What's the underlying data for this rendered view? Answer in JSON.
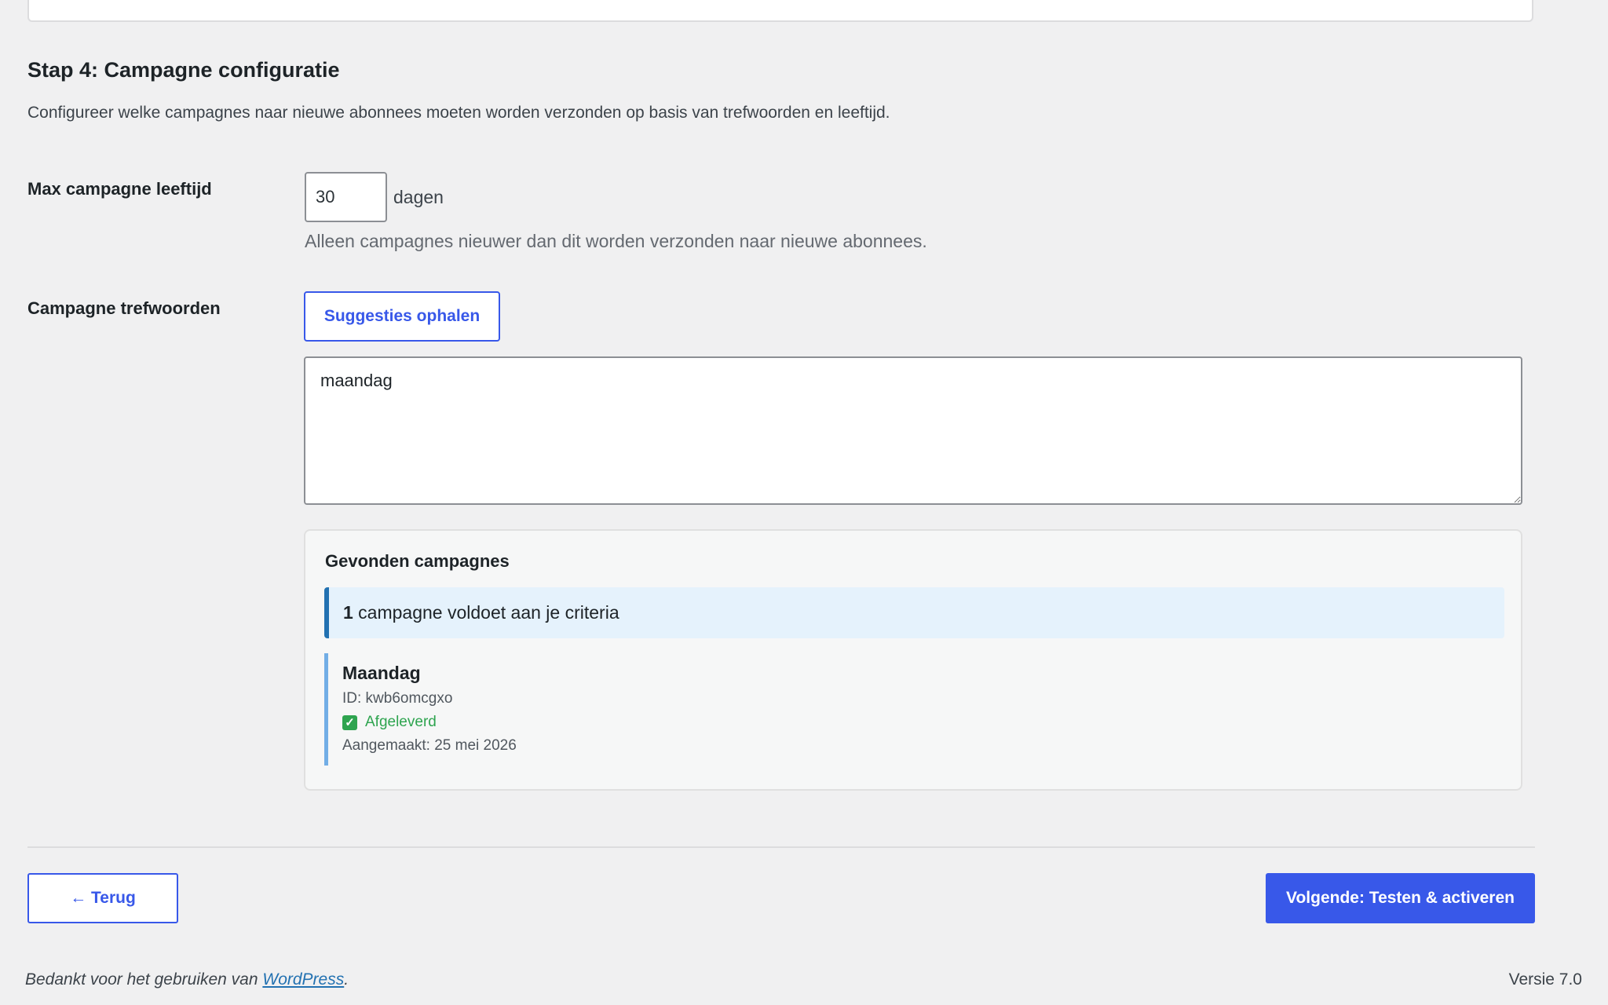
{
  "step": {
    "title": "Stap 4: Campagne configuratie",
    "description": "Configureer welke campagnes naar nieuwe abonnees moeten worden verzonden op basis van trefwoorden en leeftijd."
  },
  "max_age": {
    "label": "Max campagne leeftijd",
    "value": "30",
    "unit": "dagen",
    "help": "Alleen campagnes nieuwer dan dit worden verzonden naar nieuwe abonnees."
  },
  "keywords": {
    "label": "Campagne trefwoorden",
    "suggest_button": "Suggesties ophalen",
    "value": "maandag"
  },
  "found": {
    "title": "Gevonden campagnes",
    "count": "1",
    "notice_text": " campagne voldoet aan je criteria",
    "campaigns": [
      {
        "name": "Maandag",
        "id": "ID: kwb6omcgxo",
        "status": "Afgeleverd",
        "created": "Aangemaakt: 25 mei 2026"
      }
    ]
  },
  "navigation": {
    "back_label": "← Terug",
    "next_label": "Volgende: Testen & activeren"
  },
  "footer": {
    "thanks_prefix": "Bedankt voor het gebruiken van ",
    "link_text": "WordPress",
    "thanks_suffix": ".",
    "version": "Versie 7.0"
  },
  "colors": {
    "accent": "#3858e9",
    "success": "#2ea44f",
    "notice_border": "#2271b1",
    "notice_bg": "#e5f2fc"
  }
}
